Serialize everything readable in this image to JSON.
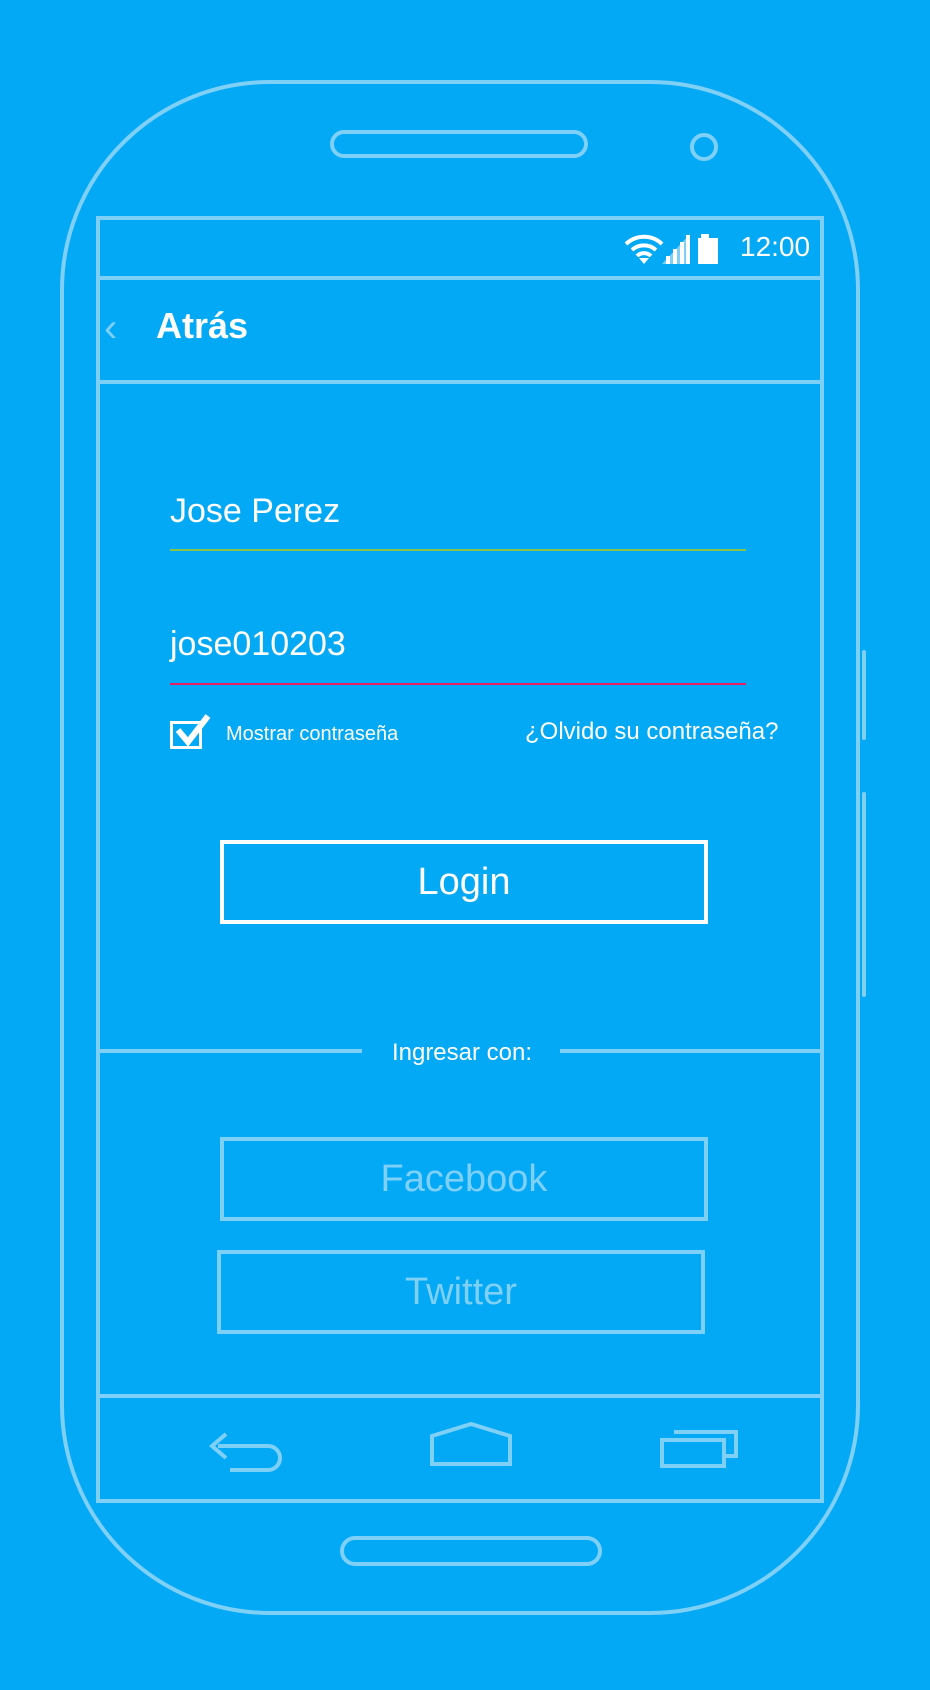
{
  "status_bar": {
    "time": "12:00",
    "icons": [
      "wifi-icon",
      "signal-icon",
      "battery-icon"
    ]
  },
  "app_bar": {
    "back_glyph": "‹",
    "title": "Atrás"
  },
  "form": {
    "username_value": "Jose Perez",
    "username_underline_color": "#8BC34A",
    "password_value": "jose010203",
    "password_underline_color": "#E91E63",
    "show_password_label": "Mostrar contraseña",
    "show_password_checked": true,
    "forgot_link": "¿Olvido su contraseña?",
    "login_button": "Login"
  },
  "social": {
    "separator_label": "Ingresar con:",
    "facebook_button": "Facebook",
    "twitter_button": "Twitter"
  },
  "nav_bar": {
    "icons": [
      "back-nav-icon",
      "home-nav-icon",
      "recents-nav-icon"
    ]
  },
  "colors": {
    "background": "#03A9F4",
    "outline": "#7fd0f7",
    "text": "#ffffff"
  }
}
